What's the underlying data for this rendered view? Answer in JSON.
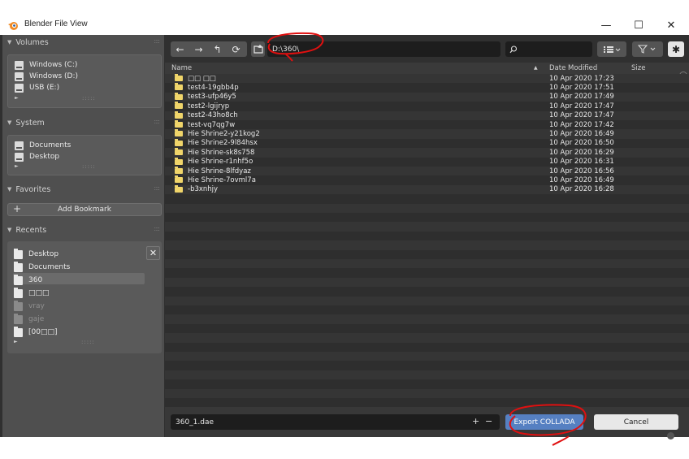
{
  "window": {
    "title": "Blender File View",
    "minimize": "—",
    "maximize": "☐",
    "close": "✕"
  },
  "sidebar": {
    "volumes": {
      "header": "Volumes",
      "items": [
        "Windows (C:)",
        "Windows (D:)",
        "USB (E:)"
      ]
    },
    "system": {
      "header": "System",
      "items": [
        "Documents",
        "Desktop"
      ]
    },
    "favorites": {
      "header": "Favorites",
      "add_bookmark": "Add Bookmark",
      "add_symbol": "+"
    },
    "recents": {
      "header": "Recents",
      "remove_symbol": "✕",
      "items": [
        "Desktop",
        "Documents",
        "360",
        "□□□",
        "vray",
        "gaje",
        "[00□□]"
      ],
      "selected": "360"
    }
  },
  "toolbar": {
    "back": "←",
    "forward": "→",
    "parent": "↰",
    "refresh": "⟳",
    "path": "D:\\360\\"
  },
  "columns": {
    "name": "Name",
    "date": "Date Modified",
    "size": "Size",
    "sort_indicator": "▲"
  },
  "files": [
    {
      "name": "□□ □□",
      "date": "10 Apr 2020 17:23"
    },
    {
      "name": "test4-19gbb4p",
      "date": "10 Apr 2020 17:51"
    },
    {
      "name": "test3-ufp46y5",
      "date": "10 Apr 2020 17:49"
    },
    {
      "name": "test2-lgijryp",
      "date": "10 Apr 2020 17:47"
    },
    {
      "name": "test2-43ho8ch",
      "date": "10 Apr 2020 17:47"
    },
    {
      "name": "test-vq7qg7w",
      "date": "10 Apr 2020 17:42"
    },
    {
      "name": "Hie Shrine2-y21kog2",
      "date": "10 Apr 2020 16:49"
    },
    {
      "name": "Hie Shrine2-9l84hsx",
      "date": "10 Apr 2020 16:50"
    },
    {
      "name": "Hie Shrine-sk8s758",
      "date": "10 Apr 2020 16:29"
    },
    {
      "name": "Hie Shrine-r1nhf5o",
      "date": "10 Apr 2020 16:31"
    },
    {
      "name": "Hie Shrine-8lfdyaz",
      "date": "10 Apr 2020 16:56"
    },
    {
      "name": "Hie Shrine-7ovml7a",
      "date": "10 Apr 2020 16:49"
    },
    {
      "name": "-b3xnhjy",
      "date": "10 Apr 2020 16:28"
    }
  ],
  "bottom": {
    "filename": "360_1.dae",
    "plus": "+",
    "minus": "−",
    "export_label": "Export COLLADA",
    "cancel_label": "Cancel"
  },
  "colors": {
    "accent": "#5680c2",
    "annotation": "#e01010",
    "folder": "#f0d56a"
  }
}
